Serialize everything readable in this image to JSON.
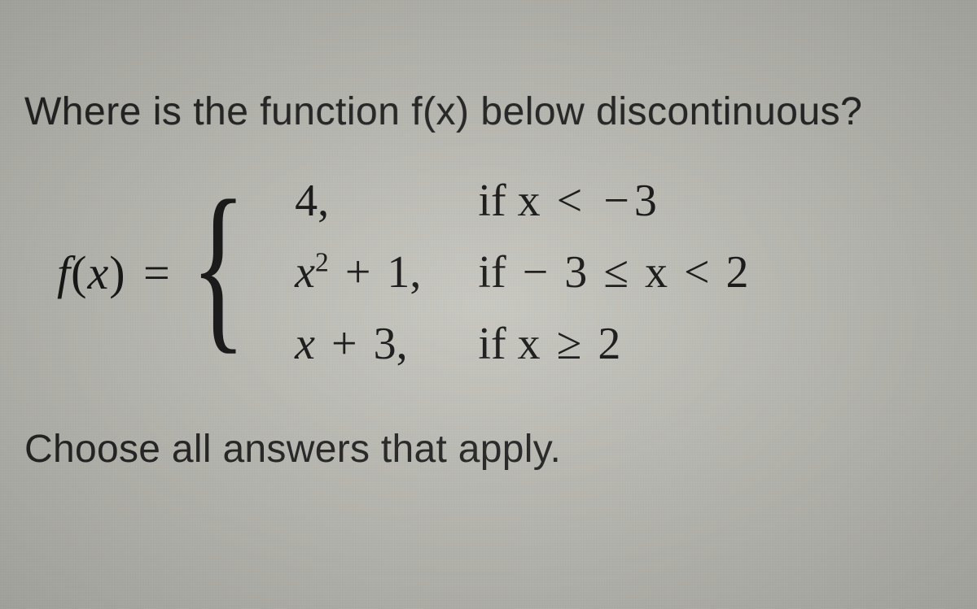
{
  "question": "Where is the function f(x) below discontinuous?",
  "equation": {
    "lhs": "f(x) =",
    "pieces": [
      {
        "expr_plain": "4,",
        "cond_plain": "if x < −3"
      },
      {
        "expr_plain": "x² + 1,",
        "cond_plain": "if − 3 ≤ x < 2"
      },
      {
        "expr_plain": "x + 3,",
        "cond_plain": "if x ≥ 2"
      }
    ]
  },
  "instructions": "Choose all answers that apply."
}
